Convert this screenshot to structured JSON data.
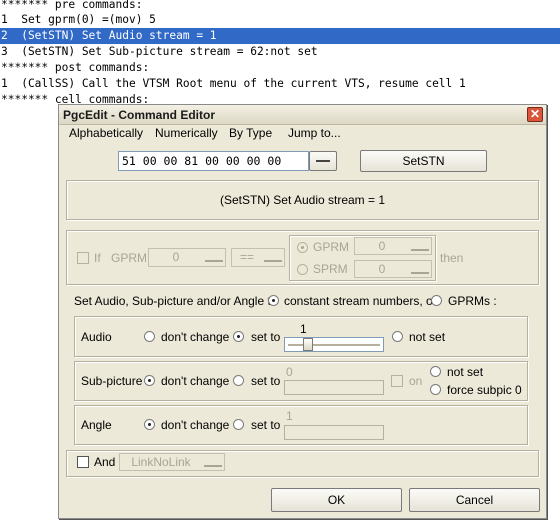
{
  "listing": {
    "lines": [
      "******* pre commands:",
      "1  Set gprm(0) =(mov) 5",
      "2  (SetSTN) Set Audio stream = 1",
      "3  (SetSTN) Set Sub-picture stream = 62:not set",
      "******* post commands:",
      "1  (CallSS) Call the VTSM Root menu of the current VTS, resume cell 1",
      "******* cell commands:"
    ],
    "selected_index": 2
  },
  "dialog": {
    "title": "PgcEdit - Command Editor",
    "close_glyph": "✕",
    "menu": [
      "Alphabetically",
      "Numerically",
      "By Type",
      "Jump to..."
    ],
    "hex_value": "51 00 00 81 00 00 00 00",
    "command_button": "SetSTN",
    "description": "(SetSTN) Set Audio stream = 1",
    "if_section": {
      "if_label": "If",
      "gprm_label": "GPRM",
      "gprm_value": "0",
      "operator": "==",
      "radio_gprm_label": "GPRM",
      "radio_gprm_value": "0",
      "radio_sprm_label": "SPRM",
      "radio_sprm_value": "0",
      "then_label": "then"
    },
    "mode_line": {
      "prefix": "Set Audio, Sub-picture and/or Angle to",
      "opt_constant": "constant stream numbers,  or",
      "opt_gprms": "GPRMs :"
    },
    "audio": {
      "label": "Audio",
      "dont_change": "don't change",
      "set_to": "set to",
      "value": "1",
      "not_set": "not set",
      "slider_fraction": 0.2
    },
    "subpicture": {
      "label": "Sub-picture",
      "dont_change": "don't change",
      "set_to": "set to",
      "value": "0",
      "on_label": "on",
      "not_set": "not set",
      "force": "force subpic 0"
    },
    "angle": {
      "label": "Angle",
      "dont_change": "don't change",
      "set_to": "set to",
      "value": "1"
    },
    "and_section": {
      "and_label": "And",
      "link_value": "LinkNoLink"
    },
    "ok": "OK",
    "cancel": "Cancel"
  }
}
